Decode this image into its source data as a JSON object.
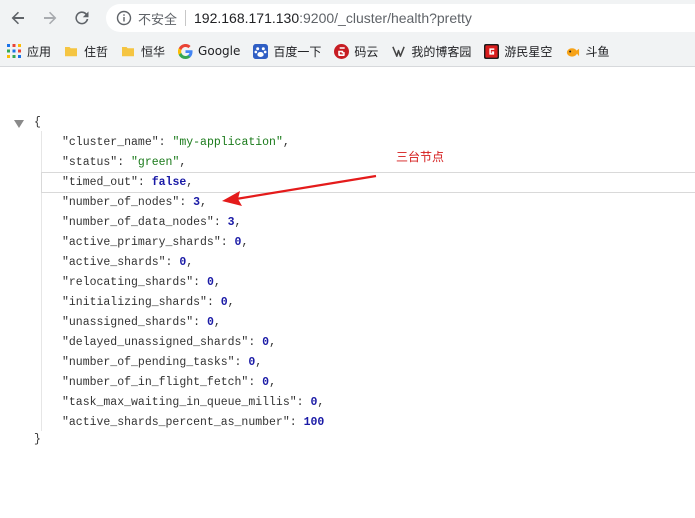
{
  "toolbar": {
    "not_secure": "不安全",
    "url_host": "192.168.171.130",
    "url_rest": ":9200/_cluster/health?pretty"
  },
  "bookmarks": [
    {
      "label": "应用",
      "icon": "apps-grid-icon"
    },
    {
      "label": "住哲",
      "icon": "folder-icon"
    },
    {
      "label": "恒华",
      "icon": "folder-icon"
    },
    {
      "label": "Google",
      "icon": "google-icon"
    },
    {
      "label": "百度一下",
      "icon": "baidu-icon"
    },
    {
      "label": "码云",
      "icon": "gitee-icon"
    },
    {
      "label": "我的博客园",
      "icon": "blog-icon"
    },
    {
      "label": "游民星空",
      "icon": "gamersky-icon"
    },
    {
      "label": "斗鱼",
      "icon": "douyu-icon"
    }
  ],
  "json": {
    "open": "{",
    "close": "}",
    "entries": [
      {
        "key": "\"cluster_name\"",
        "value": "\"my-application\"",
        "type": "s",
        "comma": ","
      },
      {
        "key": "\"status\"",
        "value": "\"green\"",
        "type": "s",
        "comma": ","
      },
      {
        "key": "\"timed_out\"",
        "value": "false",
        "type": "b",
        "comma": ","
      },
      {
        "key": "\"number_of_nodes\"",
        "value": "3",
        "type": "n",
        "comma": ","
      },
      {
        "key": "\"number_of_data_nodes\"",
        "value": "3",
        "type": "n",
        "comma": ","
      },
      {
        "key": "\"active_primary_shards\"",
        "value": "0",
        "type": "n",
        "comma": ","
      },
      {
        "key": "\"active_shards\"",
        "value": "0",
        "type": "n",
        "comma": ","
      },
      {
        "key": "\"relocating_shards\"",
        "value": "0",
        "type": "n",
        "comma": ","
      },
      {
        "key": "\"initializing_shards\"",
        "value": "0",
        "type": "n",
        "comma": ","
      },
      {
        "key": "\"unassigned_shards\"",
        "value": "0",
        "type": "n",
        "comma": ","
      },
      {
        "key": "\"delayed_unassigned_shards\"",
        "value": "0",
        "type": "n",
        "comma": ","
      },
      {
        "key": "\"number_of_pending_tasks\"",
        "value": "0",
        "type": "n",
        "comma": ","
      },
      {
        "key": "\"number_of_in_flight_fetch\"",
        "value": "0",
        "type": "n",
        "comma": ","
      },
      {
        "key": "\"task_max_waiting_in_queue_millis\"",
        "value": "0",
        "type": "n",
        "comma": ","
      },
      {
        "key": "\"active_shards_percent_as_number\"",
        "value": "100",
        "type": "n",
        "comma": ""
      }
    ]
  },
  "annotation": {
    "text": "三台节点",
    "color": "#d41a1a"
  }
}
